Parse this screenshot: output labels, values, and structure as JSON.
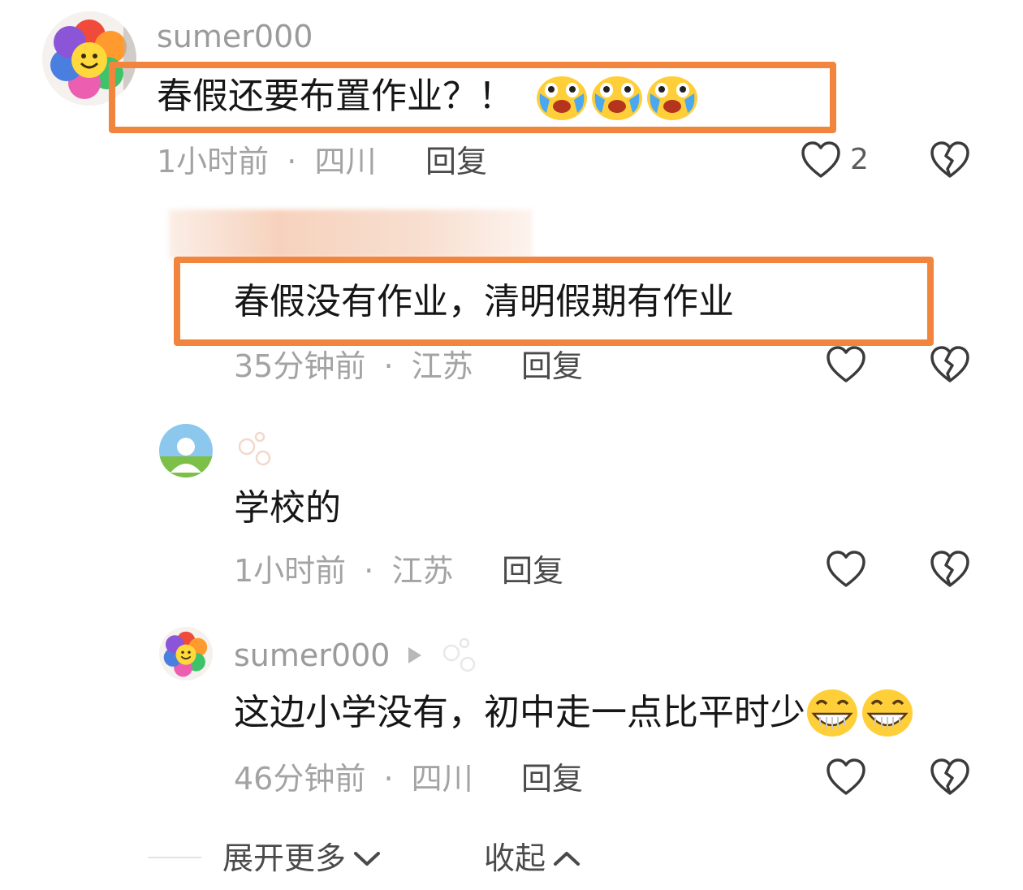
{
  "comments": [
    {
      "username": "sumer000",
      "text": "春假还要布置作业？！",
      "emoji_name": "crying-laugh-emoji",
      "emoji_count": 3,
      "time": "1小时前",
      "sep": "·",
      "location": "四川",
      "reply_label": "回复",
      "like_count": "2",
      "avatar": "flower-smiley-avatar",
      "highlighted": true
    },
    {
      "username": "",
      "text": "春假没有作业，清明假期有作业",
      "time": "35分钟前",
      "sep": "·",
      "location": "江苏",
      "reply_label": "回复",
      "highlighted": true
    },
    {
      "username": "",
      "text": "学校的",
      "time": "1小时前",
      "sep": "·",
      "location": "江苏",
      "reply_label": "回复",
      "avatar": "landscape-default-avatar"
    },
    {
      "username": "sumer000",
      "text": "这边小学没有，初中走一点比平时少",
      "emoji_name": "grin-emoji",
      "emoji_count": 2,
      "time": "46分钟前",
      "sep": "·",
      "location": "四川",
      "reply_label": "回复",
      "avatar": "flower-smiley-avatar"
    }
  ],
  "footer": {
    "expand_label": "展开更多",
    "collapse_label": "收起"
  },
  "colors": {
    "highlight": "#f2853d",
    "text": "#161616",
    "meta": "#a3a3a3"
  },
  "icons": {
    "like": "heart-outline-icon",
    "dislike": "broken-heart-icon",
    "expand": "chevron-down-icon",
    "collapse": "chevron-up-icon",
    "reply_arrow": "triangle-right-icon",
    "fan_badge": "bubbles-icon"
  }
}
